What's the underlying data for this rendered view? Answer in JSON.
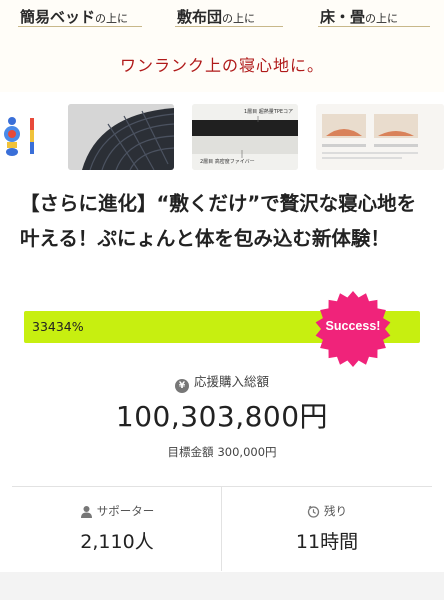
{
  "hero": {
    "labels": [
      {
        "main": "簡易ベッド",
        "small": "の上に"
      },
      {
        "main": "敷布団",
        "small": "の上に"
      },
      {
        "main": "床・畳",
        "small": "の上に"
      }
    ],
    "tagline": "ワンランク上の寝心地に。"
  },
  "carousel": {
    "slide2": {
      "text_top": "1層目 超熱量TPEコア",
      "text_bottom": "2層目 高密度ファイバー"
    }
  },
  "project": {
    "title": "【さらに進化】“敷くだけ”で贅沢な寝心地を叶える！ぷにょんと体を包み込む新体験！"
  },
  "progress": {
    "percent_label": "33434%",
    "fill_fraction": 1.0,
    "badge": "Success!",
    "colors": {
      "fill": "#c7ef10",
      "badge": "#f0237a"
    }
  },
  "funding": {
    "label": "応援購入総額",
    "total": "100,303,800円",
    "goal_label": "目標金額",
    "goal_value": "300,000円"
  },
  "stats": {
    "supporters_label": "サポーター",
    "supporters_value": "2,110人",
    "remaining_label": "残り",
    "remaining_value": "11時間"
  }
}
